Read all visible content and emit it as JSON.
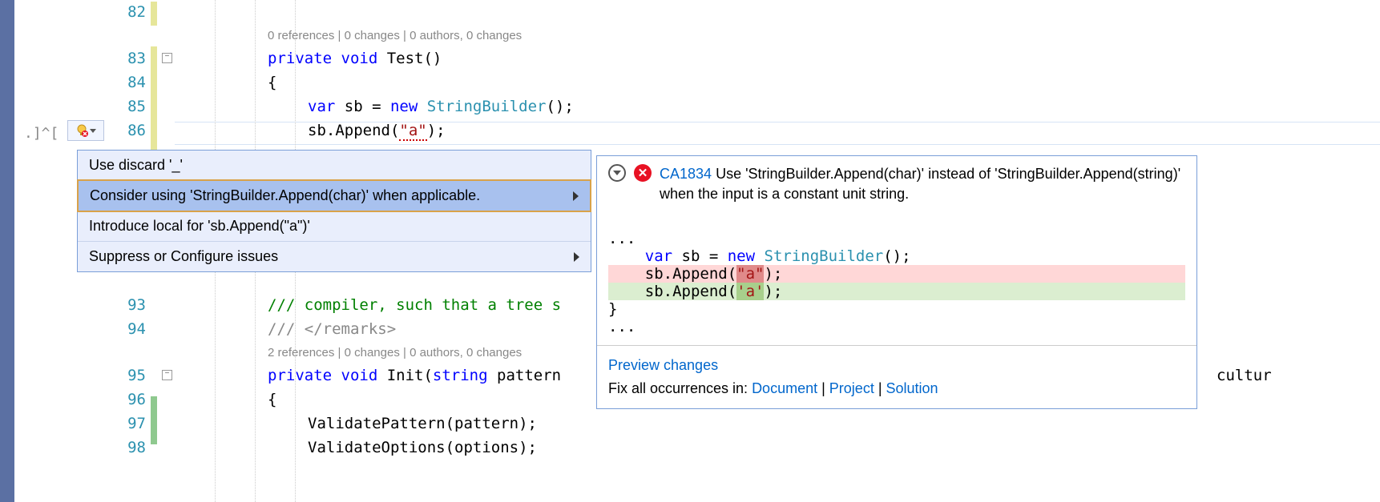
{
  "gutter": {
    "l82": "82",
    "l83": "83",
    "l84": "84",
    "l85": "85",
    "l86": "86",
    "l93": "93",
    "l94": "94",
    "l95": "95",
    "l96": "96",
    "l97": "97",
    "l98": "98"
  },
  "bracket_hint": ".]^[",
  "codelens": {
    "test": "0 references | 0 changes | 0 authors, 0 changes",
    "init": "2 references | 0 changes | 0 authors, 0 changes"
  },
  "code": {
    "l83_private": "private",
    "l83_void": " void",
    "l83_name": " Test()",
    "l84_brace": "{",
    "l85_var": "var",
    "l85_sb": " sb = ",
    "l85_new": "new",
    "l85_type": " StringBuilder",
    "l85_tail": "();",
    "l86_pre": "sb.Append(",
    "l86_str": "\"a\"",
    "l86_post": ");",
    "l93_cmt": "/// compiler, such that a tree s",
    "l94_slashes": "/// ",
    "l94_tag": "</remarks>",
    "l95_private": "private",
    "l95_void": " void",
    "l95_name": " Init(",
    "l95_string": "string",
    "l95_tail": " pattern",
    "l95_cultur": "cultur",
    "l96_brace": "{",
    "l97": "ValidatePattern(pattern);",
    "l98": "ValidateOptions(options);"
  },
  "quick_actions": {
    "item0": "Use discard '_'",
    "item1": "Consider using 'StringBuilder.Append(char)' when applicable.",
    "item2": "Introduce local for 'sb.Append(\"a\")'",
    "item3": "Suppress or Configure issues"
  },
  "preview": {
    "rule_id": "CA1834",
    "rule_msg": " Use 'StringBuilder.Append(char)' instead of 'StringBuilder.Append(string)' when the input is a constant unit string.",
    "ellipsis": "...",
    "ctx_var": "var",
    "ctx_sb": " sb = ",
    "ctx_new": "new",
    "ctx_type": " StringBuilder",
    "ctx_tail": "();",
    "del_pre": "    sb.Append(",
    "del_str": "\"a\"",
    "del_post": ");",
    "add_pre": "    sb.Append(",
    "add_str": "'a'",
    "add_post": ");",
    "close_brace": "}",
    "preview_changes": "Preview changes",
    "fix_label": "Fix all occurrences in: ",
    "fix_document": "Document",
    "fix_project": "Project",
    "fix_solution": "Solution",
    "sep": " | "
  }
}
